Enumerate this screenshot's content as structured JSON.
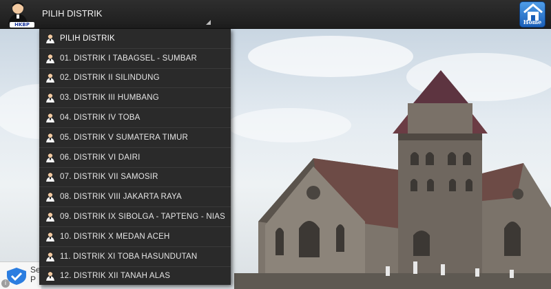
{
  "app": {
    "logo_label": "HKBP"
  },
  "spinner": {
    "selected": "PILIH DISTRIK"
  },
  "home_button": {
    "label": "Home"
  },
  "ad": {
    "text_line1": "Se",
    "text_line2": "P",
    "info_glyph": "i"
  },
  "dropdown": {
    "items": [
      "PILIH DISTRIK",
      "01. DISTRIK I TABAGSEL - SUMBAR",
      "02. DISTRIK II SILINDUNG",
      "03. DISTRIK III HUMBANG",
      "04. DISTRIK IV TOBA",
      "05. DISTRIK V SUMATERA TIMUR",
      "06. DISTRIK VI DAIRI",
      "07. DISTRIK VII SAMOSIR",
      "08. DISTRIK VIII JAKARTA RAYA",
      "09. DISTRIK IX SIBOLGA - TAPTENG - NIAS",
      "10. DISTRIK X MEDAN ACEH",
      "11. DISTRIK XI TOBA HASUNDUTAN",
      "12. DISTRIK XII TANAH ALAS"
    ]
  },
  "colors": {
    "topbar": "#1d1d1d",
    "dropdown_bg": "#2a2a2a",
    "home_blue": "#1a5fb8"
  }
}
